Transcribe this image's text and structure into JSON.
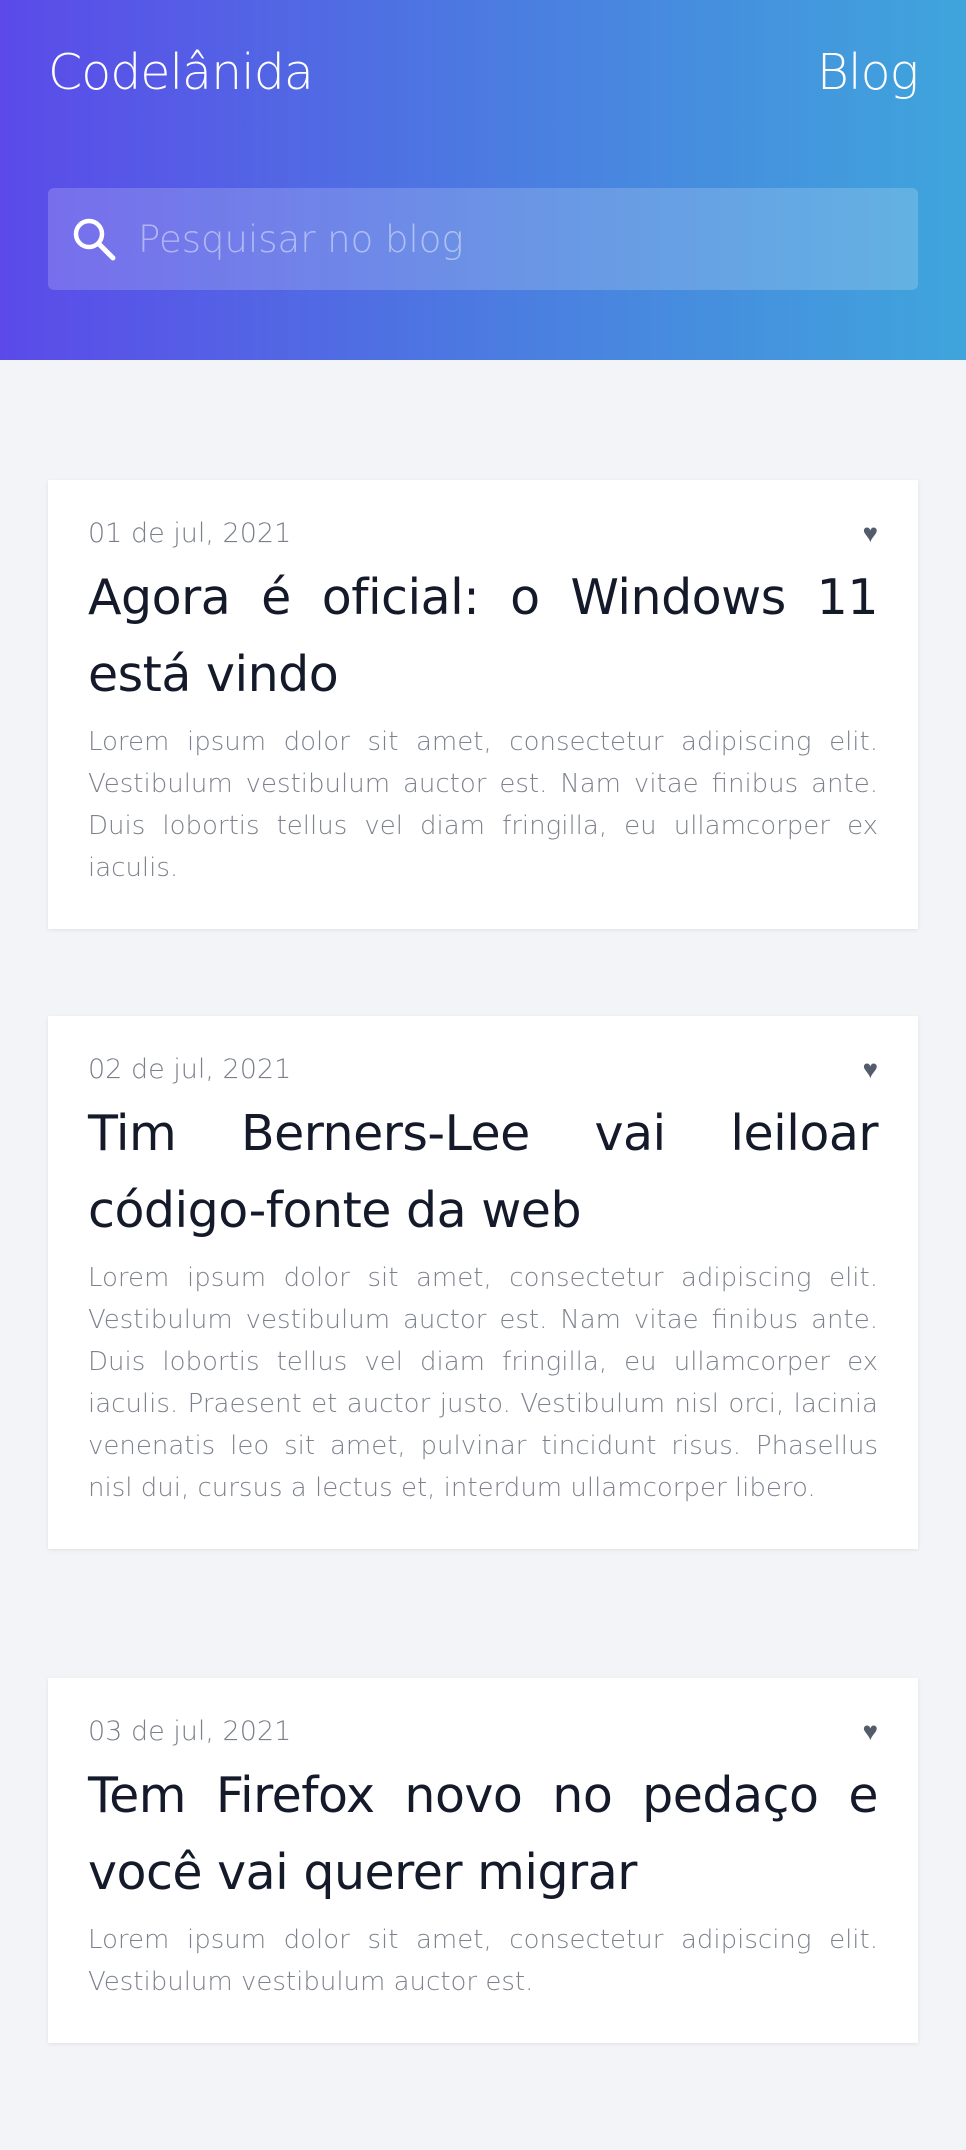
{
  "header": {
    "brand": "Codelânida",
    "nav_blog": "Blog",
    "search_placeholder": "Pesquisar no blog"
  },
  "posts": [
    {
      "date": "01 de jul, 2021",
      "title": "Agora é oficial: o Windows 11 está vindo",
      "excerpt": "Lorem ipsum dolor sit amet, consectetur adipiscing elit. Vestibulum vestibulum auctor est. Nam vitae finibus ante. Duis lobortis tellus vel diam fringilla, eu ullamcorper ex iaculis.",
      "like_icon": "heart-icon"
    },
    {
      "date": "02 de jul, 2021",
      "title": "Tim Berners-Lee vai leiloar código-fonte da web",
      "excerpt": "Lorem ipsum dolor sit amet, consectetur adipiscing elit. Vestibulum vestibulum auctor est. Nam vitae finibus ante. Duis lobortis tellus vel diam fringilla, eu ullamcorper ex iaculis. Praesent et auctor justo. Vestibulum nisl orci, lacinia venenatis leo sit amet, pulvinar tincidunt risus. Phasellus nisl dui, cursus a lectus et, interdum ullamcorper libero.",
      "like_icon": "heart-icon"
    },
    {
      "date": "03 de jul, 2021",
      "title": "Tem Firefox novo no pedaço e você vai querer migrar",
      "excerpt": "Lorem ipsum dolor sit amet, consectetur adipiscing elit. Vestibulum vestibulum auctor est.",
      "like_icon": "heart-icon"
    }
  ],
  "colors": {
    "gradient_start": "#5b4ae9",
    "gradient_end": "#3fa5dc",
    "page_background": "#f2f4f7",
    "card_background": "#ffffff"
  }
}
